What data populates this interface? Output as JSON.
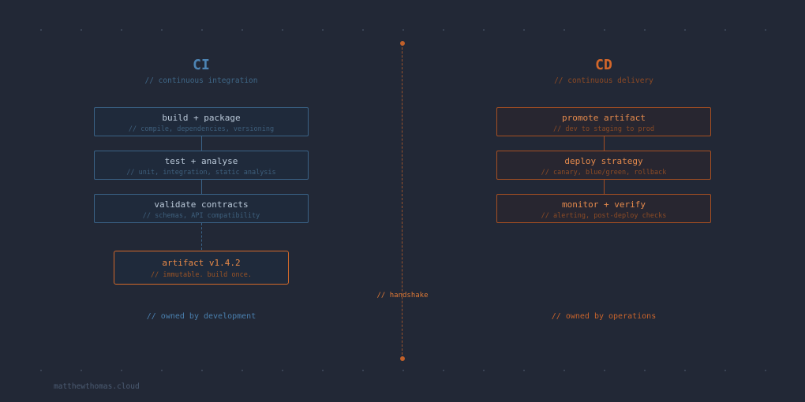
{
  "ci": {
    "title": "CI",
    "subtitle": "// continuous integration",
    "stages": [
      {
        "label": "build + package",
        "desc": "// compile, dependencies, versioning"
      },
      {
        "label": "test + analyse",
        "desc": "// unit, integration, static analysis"
      },
      {
        "label": "validate contracts",
        "desc": "// schemas, API compatibility"
      }
    ],
    "artifact": {
      "label": "artifact v1.4.2",
      "desc": "// immutable. build once."
    },
    "owner": "// owned by development"
  },
  "cd": {
    "title": "CD",
    "subtitle": "// continuous delivery",
    "stages": [
      {
        "label": "promote artifact",
        "desc": "// dev to staging to prod"
      },
      {
        "label": "deploy strategy",
        "desc": "// canary, blue/green, rollback"
      },
      {
        "label": "monitor + verify",
        "desc": "// alerting, post-deploy checks"
      }
    ],
    "owner": "// owned by operations"
  },
  "handshake": "// handshake",
  "footer": "matthewthomas.cloud",
  "colors": {
    "background": "#222836",
    "ci_accent": "#4d84b4",
    "cd_accent": "#d4672a",
    "artifact_border": "#d2692a"
  }
}
